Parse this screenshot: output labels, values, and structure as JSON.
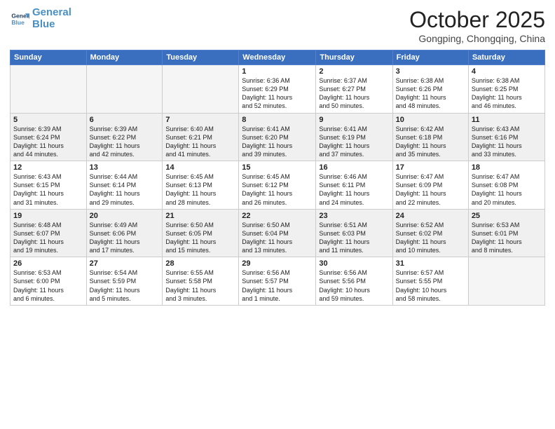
{
  "header": {
    "logo_line1": "General",
    "logo_line2": "Blue",
    "month": "October 2025",
    "location": "Gongping, Chongqing, China"
  },
  "weekdays": [
    "Sunday",
    "Monday",
    "Tuesday",
    "Wednesday",
    "Thursday",
    "Friday",
    "Saturday"
  ],
  "weeks": [
    [
      {
        "day": "",
        "info": ""
      },
      {
        "day": "",
        "info": ""
      },
      {
        "day": "",
        "info": ""
      },
      {
        "day": "1",
        "info": "Sunrise: 6:36 AM\nSunset: 6:29 PM\nDaylight: 11 hours\nand 52 minutes."
      },
      {
        "day": "2",
        "info": "Sunrise: 6:37 AM\nSunset: 6:27 PM\nDaylight: 11 hours\nand 50 minutes."
      },
      {
        "day": "3",
        "info": "Sunrise: 6:38 AM\nSunset: 6:26 PM\nDaylight: 11 hours\nand 48 minutes."
      },
      {
        "day": "4",
        "info": "Sunrise: 6:38 AM\nSunset: 6:25 PM\nDaylight: 11 hours\nand 46 minutes."
      }
    ],
    [
      {
        "day": "5",
        "info": "Sunrise: 6:39 AM\nSunset: 6:24 PM\nDaylight: 11 hours\nand 44 minutes."
      },
      {
        "day": "6",
        "info": "Sunrise: 6:39 AM\nSunset: 6:22 PM\nDaylight: 11 hours\nand 42 minutes."
      },
      {
        "day": "7",
        "info": "Sunrise: 6:40 AM\nSunset: 6:21 PM\nDaylight: 11 hours\nand 41 minutes."
      },
      {
        "day": "8",
        "info": "Sunrise: 6:41 AM\nSunset: 6:20 PM\nDaylight: 11 hours\nand 39 minutes."
      },
      {
        "day": "9",
        "info": "Sunrise: 6:41 AM\nSunset: 6:19 PM\nDaylight: 11 hours\nand 37 minutes."
      },
      {
        "day": "10",
        "info": "Sunrise: 6:42 AM\nSunset: 6:18 PM\nDaylight: 11 hours\nand 35 minutes."
      },
      {
        "day": "11",
        "info": "Sunrise: 6:43 AM\nSunset: 6:16 PM\nDaylight: 11 hours\nand 33 minutes."
      }
    ],
    [
      {
        "day": "12",
        "info": "Sunrise: 6:43 AM\nSunset: 6:15 PM\nDaylight: 11 hours\nand 31 minutes."
      },
      {
        "day": "13",
        "info": "Sunrise: 6:44 AM\nSunset: 6:14 PM\nDaylight: 11 hours\nand 29 minutes."
      },
      {
        "day": "14",
        "info": "Sunrise: 6:45 AM\nSunset: 6:13 PM\nDaylight: 11 hours\nand 28 minutes."
      },
      {
        "day": "15",
        "info": "Sunrise: 6:45 AM\nSunset: 6:12 PM\nDaylight: 11 hours\nand 26 minutes."
      },
      {
        "day": "16",
        "info": "Sunrise: 6:46 AM\nSunset: 6:11 PM\nDaylight: 11 hours\nand 24 minutes."
      },
      {
        "day": "17",
        "info": "Sunrise: 6:47 AM\nSunset: 6:09 PM\nDaylight: 11 hours\nand 22 minutes."
      },
      {
        "day": "18",
        "info": "Sunrise: 6:47 AM\nSunset: 6:08 PM\nDaylight: 11 hours\nand 20 minutes."
      }
    ],
    [
      {
        "day": "19",
        "info": "Sunrise: 6:48 AM\nSunset: 6:07 PM\nDaylight: 11 hours\nand 19 minutes."
      },
      {
        "day": "20",
        "info": "Sunrise: 6:49 AM\nSunset: 6:06 PM\nDaylight: 11 hours\nand 17 minutes."
      },
      {
        "day": "21",
        "info": "Sunrise: 6:50 AM\nSunset: 6:05 PM\nDaylight: 11 hours\nand 15 minutes."
      },
      {
        "day": "22",
        "info": "Sunrise: 6:50 AM\nSunset: 6:04 PM\nDaylight: 11 hours\nand 13 minutes."
      },
      {
        "day": "23",
        "info": "Sunrise: 6:51 AM\nSunset: 6:03 PM\nDaylight: 11 hours\nand 11 minutes."
      },
      {
        "day": "24",
        "info": "Sunrise: 6:52 AM\nSunset: 6:02 PM\nDaylight: 11 hours\nand 10 minutes."
      },
      {
        "day": "25",
        "info": "Sunrise: 6:53 AM\nSunset: 6:01 PM\nDaylight: 11 hours\nand 8 minutes."
      }
    ],
    [
      {
        "day": "26",
        "info": "Sunrise: 6:53 AM\nSunset: 6:00 PM\nDaylight: 11 hours\nand 6 minutes."
      },
      {
        "day": "27",
        "info": "Sunrise: 6:54 AM\nSunset: 5:59 PM\nDaylight: 11 hours\nand 5 minutes."
      },
      {
        "day": "28",
        "info": "Sunrise: 6:55 AM\nSunset: 5:58 PM\nDaylight: 11 hours\nand 3 minutes."
      },
      {
        "day": "29",
        "info": "Sunrise: 6:56 AM\nSunset: 5:57 PM\nDaylight: 11 hours\nand 1 minute."
      },
      {
        "day": "30",
        "info": "Sunrise: 6:56 AM\nSunset: 5:56 PM\nDaylight: 10 hours\nand 59 minutes."
      },
      {
        "day": "31",
        "info": "Sunrise: 6:57 AM\nSunset: 5:55 PM\nDaylight: 10 hours\nand 58 minutes."
      },
      {
        "day": "",
        "info": ""
      }
    ]
  ]
}
